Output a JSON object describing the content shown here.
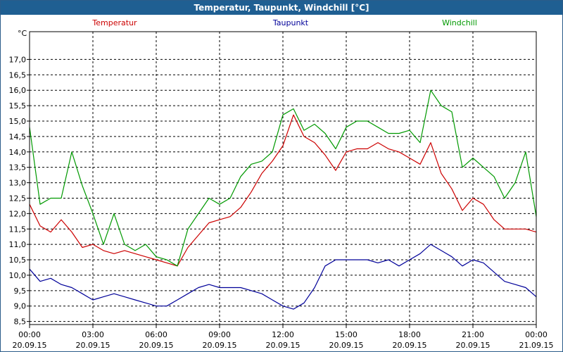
{
  "window": {
    "title": "Temperatur, Taupunkt, Windchill [°C]"
  },
  "chart_data": {
    "type": "line",
    "title": "Temperatur, Taupunkt, Windchill [°C]",
    "ylabel": "°C",
    "xlabel": "",
    "grid": true,
    "legend": "top",
    "ylim": [
      8.4,
      17.9
    ],
    "xlim": [
      0,
      24
    ],
    "yticks": [
      8.5,
      9.0,
      9.5,
      10.0,
      10.5,
      11.0,
      11.5,
      12.0,
      12.5,
      13.0,
      13.5,
      14.0,
      14.5,
      15.0,
      15.5,
      16.0,
      16.5,
      17.0
    ],
    "ytick_labels": [
      "8,5",
      "9,0",
      "9,5",
      "10,0",
      "10,5",
      "11,0",
      "11,5",
      "12,0",
      "12,5",
      "13,0",
      "13,5",
      "14,0",
      "14,5",
      "15,0",
      "15,5",
      "16,0",
      "16,5",
      "17,0"
    ],
    "xticks": [
      {
        "hour": 0,
        "time": "00:00",
        "date": "20.09.15"
      },
      {
        "hour": 3,
        "time": "03:00",
        "date": "20.09.15"
      },
      {
        "hour": 6,
        "time": "06:00",
        "date": "20.09.15"
      },
      {
        "hour": 9,
        "time": "09:00",
        "date": "20.09.15"
      },
      {
        "hour": 12,
        "time": "12:00",
        "date": "20.09.15"
      },
      {
        "hour": 15,
        "time": "15:00",
        "date": "20.09.15"
      },
      {
        "hour": 18,
        "time": "18:00",
        "date": "20.09.15"
      },
      {
        "hour": 21,
        "time": "21:00",
        "date": "20.09.15"
      },
      {
        "hour": 24,
        "time": "00:00",
        "date": "21.09.15"
      }
    ],
    "x": [
      0,
      0.5,
      1,
      1.5,
      2,
      2.5,
      3,
      3.5,
      4,
      4.5,
      5,
      5.5,
      6,
      6.5,
      7,
      7.5,
      8,
      8.5,
      9,
      9.5,
      10,
      10.5,
      11,
      11.5,
      12,
      12.5,
      13,
      13.5,
      14,
      14.5,
      15,
      15.5,
      16,
      16.5,
      17,
      17.5,
      18,
      18.5,
      19,
      19.5,
      20,
      20.5,
      21,
      21.5,
      22,
      22.5,
      23,
      23.5,
      24
    ],
    "series": [
      {
        "name": "Temperatur",
        "color": "#cc0000",
        "values": [
          12.3,
          11.6,
          11.4,
          11.8,
          11.4,
          10.9,
          11.0,
          10.8,
          10.7,
          10.8,
          10.7,
          10.6,
          10.5,
          10.4,
          10.3,
          10.9,
          11.3,
          11.7,
          11.8,
          11.9,
          12.2,
          12.7,
          13.3,
          13.7,
          14.2,
          15.2,
          14.5,
          14.3,
          13.9,
          13.4,
          14.0,
          14.1,
          14.1,
          14.3,
          14.1,
          14.0,
          13.8,
          13.6,
          14.3,
          13.3,
          12.8,
          12.1,
          12.5,
          12.3,
          11.8,
          11.5,
          11.5,
          11.5,
          11.4
        ]
      },
      {
        "name": "Taupunkt",
        "color": "#000099",
        "values": [
          10.2,
          9.8,
          9.9,
          9.7,
          9.6,
          9.4,
          9.2,
          9.3,
          9.4,
          9.3,
          9.2,
          9.1,
          9.0,
          9.0,
          9.2,
          9.4,
          9.6,
          9.7,
          9.6,
          9.6,
          9.6,
          9.5,
          9.4,
          9.2,
          9.0,
          8.9,
          9.1,
          9.6,
          10.3,
          10.5,
          10.5,
          10.5,
          10.5,
          10.4,
          10.5,
          10.3,
          10.5,
          10.7,
          11.0,
          10.8,
          10.6,
          10.3,
          10.5,
          10.4,
          10.1,
          9.8,
          9.7,
          9.6,
          9.3
        ]
      },
      {
        "name": "Windchill",
        "color": "#009900",
        "values": [
          14.8,
          12.3,
          12.5,
          12.5,
          14.0,
          12.9,
          12.0,
          11.0,
          12.0,
          11.0,
          10.8,
          11.0,
          10.6,
          10.5,
          10.3,
          11.5,
          12.0,
          12.5,
          12.3,
          12.5,
          13.2,
          13.6,
          13.7,
          14.0,
          15.2,
          15.4,
          14.7,
          14.9,
          14.6,
          14.1,
          14.8,
          15.0,
          15.0,
          14.8,
          14.6,
          14.6,
          14.7,
          14.3,
          16.0,
          15.5,
          15.3,
          13.5,
          13.8,
          13.5,
          13.2,
          12.5,
          13.0,
          14.0,
          11.9
        ]
      }
    ]
  }
}
